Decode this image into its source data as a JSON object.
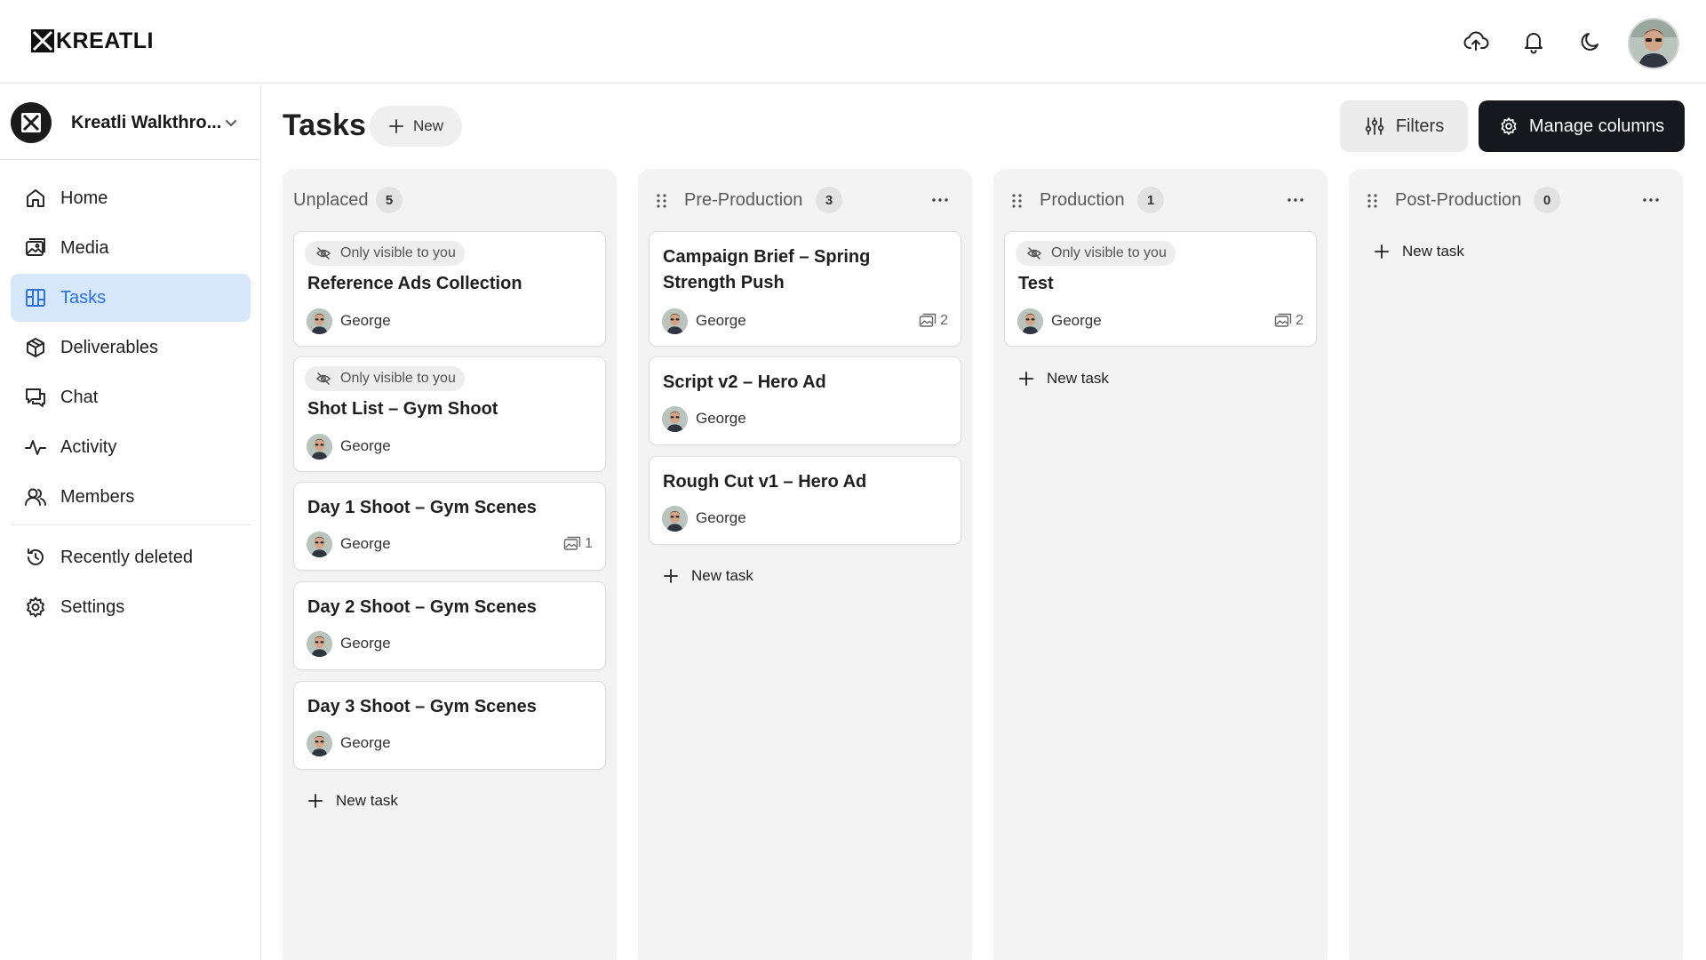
{
  "brand": {
    "name": "KREATLI"
  },
  "topbar": {
    "icons": [
      "cloud-upload-icon",
      "bell-icon",
      "moon-icon",
      "avatar"
    ]
  },
  "sidebar": {
    "workspace_name": "Kreatli Walkthro...",
    "items": [
      {
        "label": "Home",
        "icon": "home-icon",
        "active": false
      },
      {
        "label": "Media",
        "icon": "media-icon",
        "active": false
      },
      {
        "label": "Tasks",
        "icon": "tasks-icon",
        "active": true
      },
      {
        "label": "Deliverables",
        "icon": "package-icon",
        "active": false
      },
      {
        "label": "Chat",
        "icon": "chat-icon",
        "active": false
      },
      {
        "label": "Activity",
        "icon": "activity-icon",
        "active": false
      },
      {
        "label": "Members",
        "icon": "members-icon",
        "active": false
      }
    ],
    "secondary": [
      {
        "label": "Recently deleted",
        "icon": "history-icon"
      },
      {
        "label": "Settings",
        "icon": "gear-icon"
      }
    ]
  },
  "header": {
    "title": "Tasks",
    "new_label": "New",
    "filters_label": "Filters",
    "manage_label": "Manage columns"
  },
  "board": {
    "new_task_label": "New task",
    "visibility_label": "Only visible to you",
    "columns": [
      {
        "title": "Unplaced",
        "count": "5",
        "cards": [
          {
            "title": "Reference Ads Collection",
            "assignee": "George",
            "private": true,
            "attachments": ""
          },
          {
            "title": "Shot List – Gym Shoot",
            "assignee": "George",
            "private": true,
            "attachments": ""
          },
          {
            "title": "Day 1 Shoot – Gym Scenes",
            "assignee": "George",
            "private": false,
            "attachments": "1"
          },
          {
            "title": "Day 2 Shoot – Gym Scenes",
            "assignee": "George",
            "private": false,
            "attachments": ""
          },
          {
            "title": "Day 3 Shoot – Gym Scenes",
            "assignee": "George",
            "private": false,
            "attachments": ""
          }
        ]
      },
      {
        "title": "Pre-Production",
        "count": "3",
        "cards": [
          {
            "title": "Campaign Brief – Spring Strength Push",
            "assignee": "George",
            "private": false,
            "attachments": "2"
          },
          {
            "title": "Script v2 – Hero Ad",
            "assignee": "George",
            "private": false,
            "attachments": ""
          },
          {
            "title": "Rough Cut v1 – Hero Ad",
            "assignee": "George",
            "private": false,
            "attachments": ""
          }
        ]
      },
      {
        "title": "Production",
        "count": "1",
        "cards": [
          {
            "title": "Test",
            "assignee": "George",
            "private": true,
            "attachments": "2"
          }
        ]
      },
      {
        "title": "Post-Production",
        "count": "0",
        "cards": []
      }
    ]
  },
  "colors": {
    "accent": "#2c6fd6",
    "active_bg": "#d6e6fb",
    "dark_button": "#15181c",
    "column_bg": "#f3f3f3"
  }
}
